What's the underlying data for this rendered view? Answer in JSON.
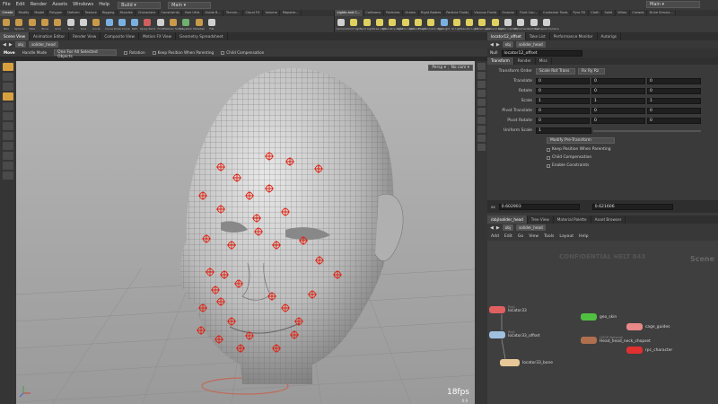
{
  "menubar": {
    "items": [
      "File",
      "Edit",
      "Render",
      "Assets",
      "Windows",
      "Help"
    ],
    "desktop": "Build",
    "network": "Main",
    "right_network": "Main"
  },
  "shelf_left": {
    "tabs": [
      "Create",
      "Modify",
      "Model",
      "Polygon",
      "Deform",
      "Texture",
      "Rigging",
      "Muscles",
      "Characters",
      "Constraints",
      "Hair Utils",
      "Guide B...",
      "Terrain...",
      "Cloud FX",
      "Volume",
      "Mapster..."
    ],
    "tools": [
      {
        "label": "Box",
        "color": "#c89a4a"
      },
      {
        "label": "Sphere",
        "color": "#c89a4a"
      },
      {
        "label": "Tube",
        "color": "#c89a4a"
      },
      {
        "label": "Torus",
        "color": "#c89a4a"
      },
      {
        "label": "Grid",
        "color": "#c89a4a"
      },
      {
        "label": "Null",
        "color": "#d0d0d0"
      },
      {
        "label": "Line",
        "color": "#d0d0d0"
      },
      {
        "label": "Circle",
        "color": "#c89a4a"
      },
      {
        "label": "Curve",
        "color": "#7ab0e0"
      },
      {
        "label": "Draw Curve",
        "color": "#7ab0e0"
      },
      {
        "label": "Path",
        "color": "#7ab0e0"
      },
      {
        "label": "Spray Paint",
        "color": "#d06060"
      },
      {
        "label": "Font",
        "color": "#d0d0d0"
      },
      {
        "label": "Platonic Solids",
        "color": "#c89a4a"
      },
      {
        "label": "L-System",
        "color": "#70b070"
      },
      {
        "label": "Metaball",
        "color": "#c89a4a"
      },
      {
        "label": "File",
        "color": "#d0d0d0"
      }
    ]
  },
  "shelf_right": {
    "tabs": [
      "Lights and C...",
      "Collisions",
      "Particles",
      "Grains",
      "Rigid Bodies",
      "Particle Fluids",
      "Viscous Fluids",
      "Oceans",
      "Fluid Con...",
      "Container Tools",
      "Pyro FX",
      "Cloth",
      "Solid",
      "Wires",
      "Crowds",
      "Drive Simula..."
    ],
    "tools": [
      {
        "label": "Camera",
        "color": "#d0d0d0"
      },
      {
        "label": "Point Light",
        "color": "#e0d060"
      },
      {
        "label": "Spot Light",
        "color": "#e0d060"
      },
      {
        "label": "Area Light",
        "color": "#e0d060"
      },
      {
        "label": "Geometry Light",
        "color": "#e0d060"
      },
      {
        "label": "Volume Light",
        "color": "#e0d060"
      },
      {
        "label": "Distant Light",
        "color": "#e0d060"
      },
      {
        "label": "Environment Light",
        "color": "#e0d060"
      },
      {
        "label": "Sky Light",
        "color": "#7ab0e0"
      },
      {
        "label": "GI Light",
        "color": "#e0d060"
      },
      {
        "label": "Caustic Light",
        "color": "#e0d060"
      },
      {
        "label": "Portal Light",
        "color": "#e0d060"
      },
      {
        "label": "Ambient Light",
        "color": "#e0d060"
      },
      {
        "label": "Stereo Camera",
        "color": "#d0d0d0"
      },
      {
        "label": "VR Camera",
        "color": "#d0d0d0"
      },
      {
        "label": "Switcher",
        "color": "#d0d0d0"
      },
      {
        "label": "Gamepad Camera",
        "color": "#d0d0d0"
      }
    ]
  },
  "viewport_tabs": [
    "Scene View",
    "Animation Editor",
    "Render View",
    "Composite View",
    "Motion FX View",
    "Geometry Spreadsheet"
  ],
  "viewport_path": {
    "root": "obj",
    "node": "solider_head"
  },
  "viewport_opts": {
    "tool": "Move",
    "handle_mode": "Handle Mode",
    "selection": "One For All Selected Objects",
    "rotation": "Rotation",
    "keep_position": "Keep Position When Parenting",
    "child_comp": "Child Compensation"
  },
  "viewport": {
    "camera": "Persp",
    "cam_menu": "No cam",
    "fps": "18fps",
    "time": "0.9"
  },
  "param_tabs": [
    "locator12_offset",
    "Take List",
    "Performance Monitor",
    "Autorigs"
  ],
  "param_path": {
    "root": "obj",
    "node": "solider_head"
  },
  "param_node": {
    "type": "Null",
    "name": "locator12_offset"
  },
  "param_subtabs": [
    "Transform",
    "Render",
    "Misc"
  ],
  "params": {
    "transform_order_label": "Transform Order",
    "transform_order": "Scale Rot Trans",
    "rot_order": "Rx Ry Rz",
    "rows": [
      {
        "label": "Translate",
        "v": [
          "0",
          "0",
          "0"
        ]
      },
      {
        "label": "Rotate",
        "v": [
          "0",
          "0",
          "0"
        ]
      },
      {
        "label": "Scale",
        "v": [
          "1",
          "1",
          "1"
        ]
      },
      {
        "label": "Pivot Translate",
        "v": [
          "0",
          "0",
          "0"
        ]
      },
      {
        "label": "Pivot Rotate",
        "v": [
          "0",
          "0",
          "0"
        ]
      }
    ],
    "uniform_scale_label": "Uniform Scale",
    "uniform_scale": "1",
    "modify_pre": "Modify Pre-Transform",
    "keep_pos": "Keep Position When Parenting",
    "child_comp": "Child Compensation",
    "enable_constraints": "Enable Constraints",
    "readout_a": "0.602903",
    "readout_b": "0.621606",
    "readout_label": "xx"
  },
  "network_tabs": [
    "/obj/solider_head",
    "Tree View",
    "Material Palette",
    "Asset Browser"
  ],
  "network_path": {
    "root": "obj",
    "node": "solider_head"
  },
  "network_menu": [
    "Add",
    "Edit",
    "Go",
    "View",
    "Tools",
    "Layout",
    "Help"
  ],
  "network": {
    "watermark": "CONFIDENTIAL HELT 843",
    "context": "Scene",
    "nodes": [
      {
        "name": "locator33",
        "sub": "Rig1",
        "color": "#e06060"
      },
      {
        "name": "locator33_offset",
        "sub": "Rig1",
        "color": "#a0c0e0"
      },
      {
        "name": "locator33_bone",
        "sub": "",
        "color": "#e8c898"
      },
      {
        "name": "geo_skin",
        "sub": "",
        "color": "#50c040"
      },
      {
        "name": "Head_head_neck_chopset",
        "sub": "CHOP Network",
        "color": "#b07050"
      },
      {
        "name": "cage_guides",
        "sub": "",
        "color": "#e88888"
      },
      {
        "name": "rpc_character",
        "sub": "",
        "color": "#e03030"
      }
    ]
  },
  "locator_color": "#e02010"
}
